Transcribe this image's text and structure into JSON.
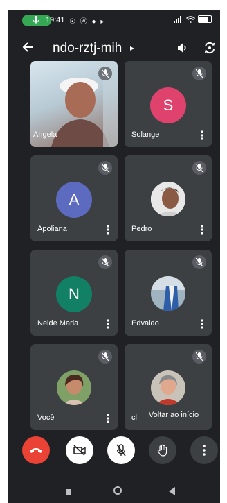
{
  "status_bar": {
    "time": "19:41",
    "notification_icons": "☉ ⓦ ● ▸"
  },
  "header": {
    "meeting_code": "ndo-rztj-mih",
    "code_chevron": "▸"
  },
  "participants": [
    {
      "name": "Angela",
      "avatar_type": "video",
      "muted": true
    },
    {
      "name": "Solange",
      "avatar_type": "letter",
      "letter": "S",
      "color": "#e0426e",
      "muted": true
    },
    {
      "name": "Apoliana",
      "avatar_type": "letter",
      "letter": "A",
      "color": "#5c6bc0",
      "muted": true
    },
    {
      "name": "Pedro",
      "avatar_type": "photo",
      "muted": true
    },
    {
      "name": "Neide Maria",
      "avatar_type": "letter",
      "letter": "N",
      "color": "#128064",
      "muted": true
    },
    {
      "name": "Edvaldo",
      "avatar_type": "photo",
      "muted": true
    },
    {
      "name": "Você",
      "avatar_type": "photo",
      "muted": true
    },
    {
      "name": "cl",
      "avatar_type": "photo",
      "muted": true
    }
  ],
  "toast": "Voltar ao início",
  "controls": {
    "end_call_color": "#ea4335",
    "icons": [
      "phone-end-icon",
      "camera-off-icon",
      "mic-off-icon",
      "raise-hand-icon",
      "more-vert-icon"
    ]
  },
  "colors": {
    "background": "#202124",
    "tile": "#3c4043",
    "mic_indicator": "#34a853"
  }
}
